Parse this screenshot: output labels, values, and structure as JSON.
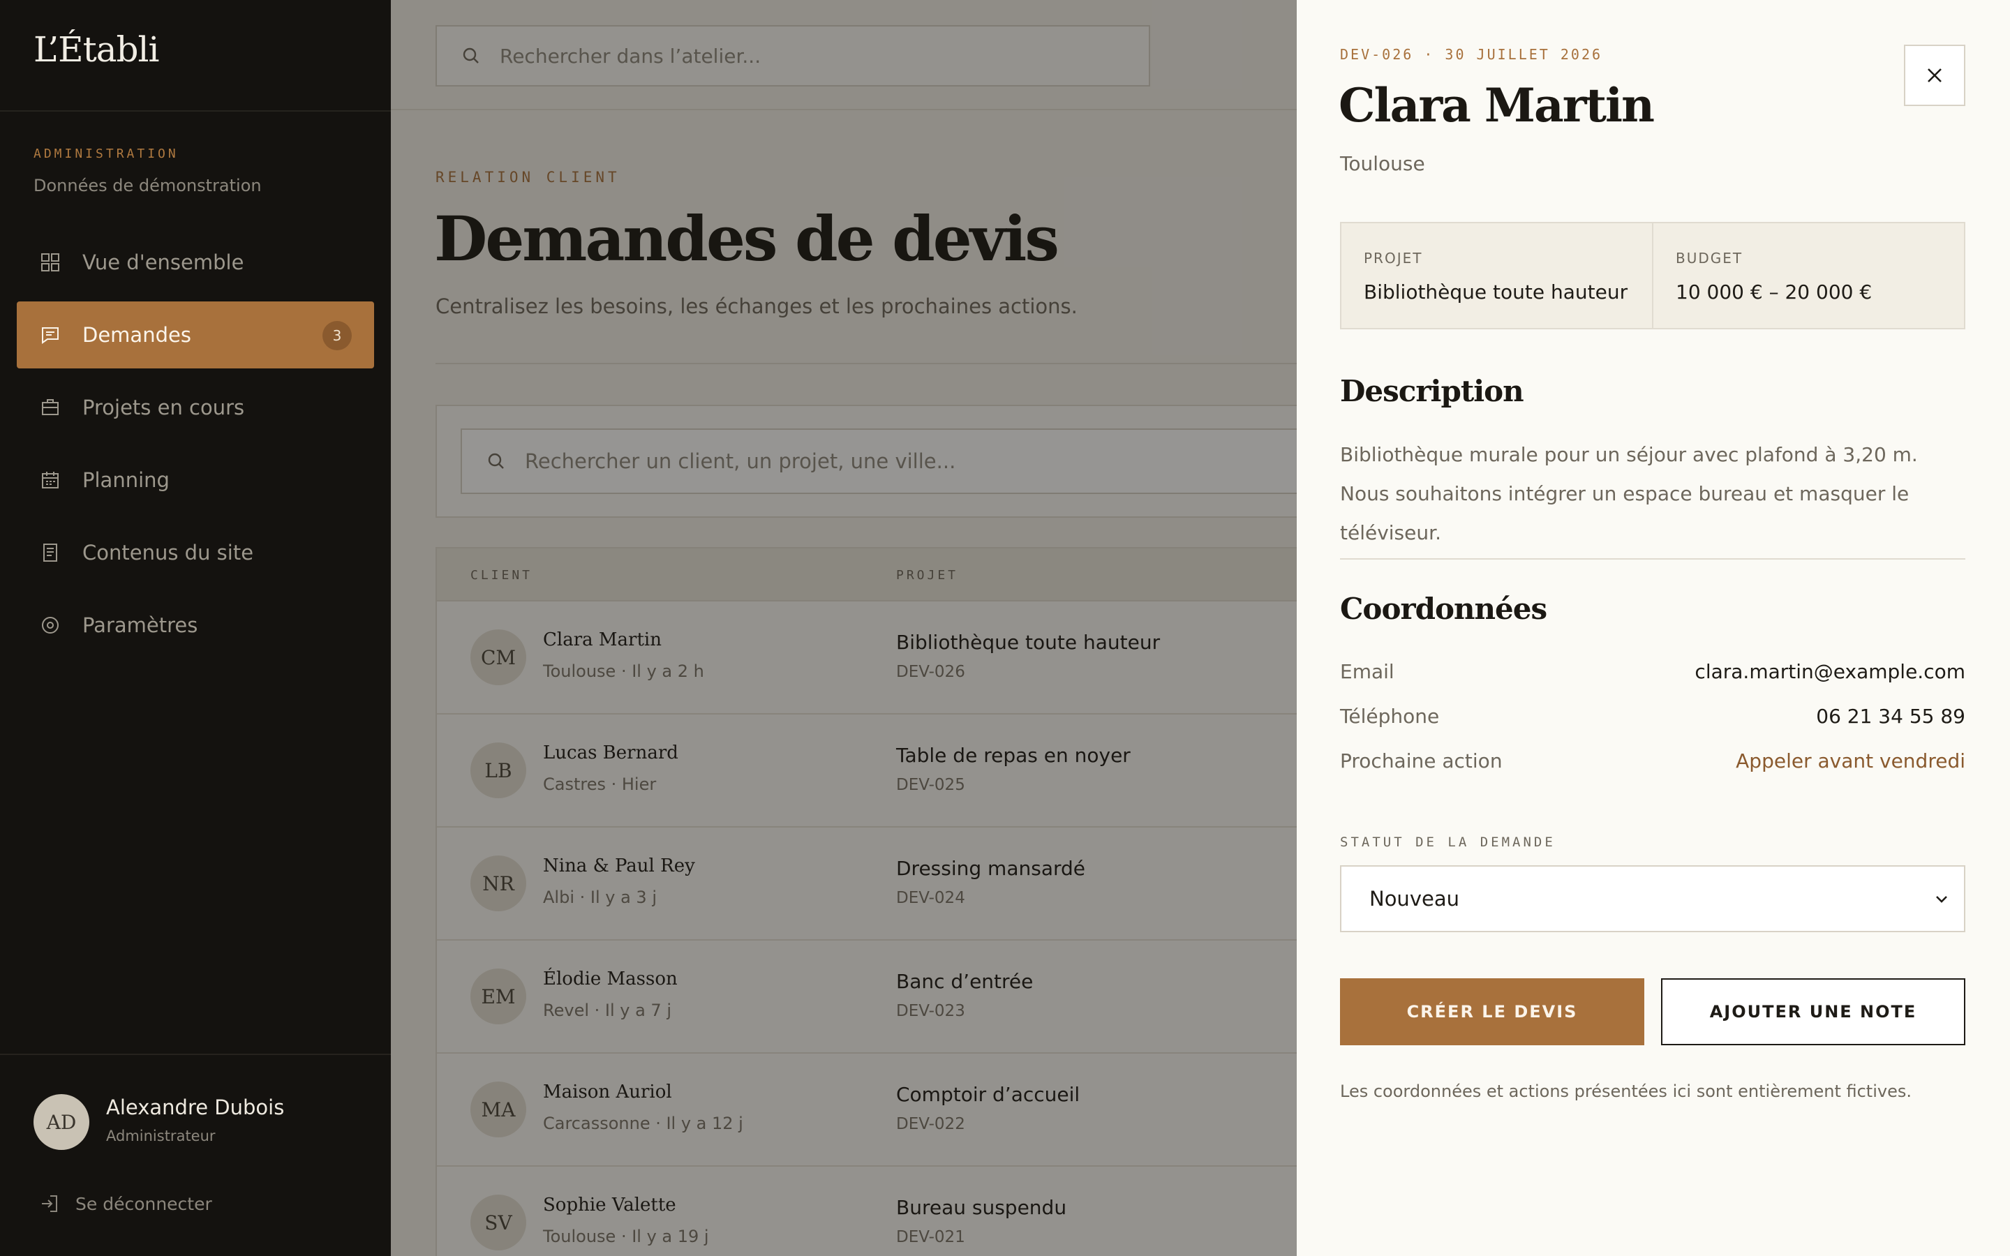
{
  "sidebar": {
    "brand": "L’Établi",
    "section_label": "ADMINISTRATION",
    "section_sub": "Données de démonstration",
    "items": [
      {
        "label": "Vue d'ensemble",
        "icon": "grid-icon"
      },
      {
        "label": "Demandes",
        "icon": "message-icon",
        "badge": "3",
        "active": true
      },
      {
        "label": "Projets en cours",
        "icon": "briefcase-icon"
      },
      {
        "label": "Planning",
        "icon": "calendar-icon"
      },
      {
        "label": "Contenus du site",
        "icon": "document-icon"
      },
      {
        "label": "Paramètres",
        "icon": "settings-icon"
      }
    ],
    "user": {
      "initials": "AD",
      "name": "Alexandre Dubois",
      "role": "Administrateur"
    },
    "logout_label": "Se déconnecter"
  },
  "topbar": {
    "search_placeholder": "Rechercher dans l’atelier..."
  },
  "main": {
    "eyebrow": "RELATION CLIENT",
    "title": "Demandes de devis",
    "subtitle": "Centralisez les besoins, les échanges et les prochaines actions.",
    "filter_placeholder": "Rechercher un client, un projet, une ville...",
    "table": {
      "headers": {
        "client": "CLIENT",
        "project": "PROJET"
      },
      "rows": [
        {
          "initials": "CM",
          "name": "Clara Martin",
          "meta": "Toulouse · Il y a 2 h",
          "project": "Bibliothèque toute hauteur",
          "ref": "DEV-026"
        },
        {
          "initials": "LB",
          "name": "Lucas Bernard",
          "meta": "Castres · Hier",
          "project": "Table de repas en noyer",
          "ref": "DEV-025"
        },
        {
          "initials": "NR",
          "name": "Nina & Paul Rey",
          "meta": "Albi · Il y a 3 j",
          "project": "Dressing mansardé",
          "ref": "DEV-024"
        },
        {
          "initials": "EM",
          "name": "Élodie Masson",
          "meta": "Revel · Il y a 7 j",
          "project": "Banc d’entrée",
          "ref": "DEV-023"
        },
        {
          "initials": "MA",
          "name": "Maison Auriol",
          "meta": "Carcassonne · Il y a 12 j",
          "project": "Comptoir d’accueil",
          "ref": "DEV-022"
        },
        {
          "initials": "SV",
          "name": "Sophie Valette",
          "meta": "Toulouse · Il y a 19 j",
          "project": "Bureau suspendu",
          "ref": "DEV-021"
        }
      ]
    }
  },
  "drawer": {
    "ref": "DEV-026 · 30 JUILLET 2026",
    "name": "Clara Martin",
    "city": "Toulouse",
    "project_label": "PROJET",
    "project_value": "Bibliothèque toute hauteur",
    "budget_label": "BUDGET",
    "budget_value": "10 000 € – 20 000 €",
    "description_title": "Description",
    "description": "Bibliothèque murale pour un séjour avec plafond à 3,20 m. Nous souhaitons intégrer un espace bureau et masquer le téléviseur.",
    "contact_title": "Coordonnées",
    "email_label": "Email",
    "email_value": "clara.martin@example.com",
    "phone_label": "Téléphone",
    "phone_value": "06 21 34 55 89",
    "next_label": "Prochaine action",
    "next_value": "Appeler avant vendredi",
    "status_label": "STATUT DE LA DEMANDE",
    "status_value": "Nouveau",
    "primary_button": "CRÉER LE DEVIS",
    "secondary_button": "AJOUTER UNE NOTE",
    "footnote": "Les coordonnées et actions présentées ici sont entièrement fictives."
  },
  "colors": {
    "accent": "#a8713c",
    "sidebar_bg": "#14120f",
    "drawer_bg": "#fbfaf5"
  }
}
